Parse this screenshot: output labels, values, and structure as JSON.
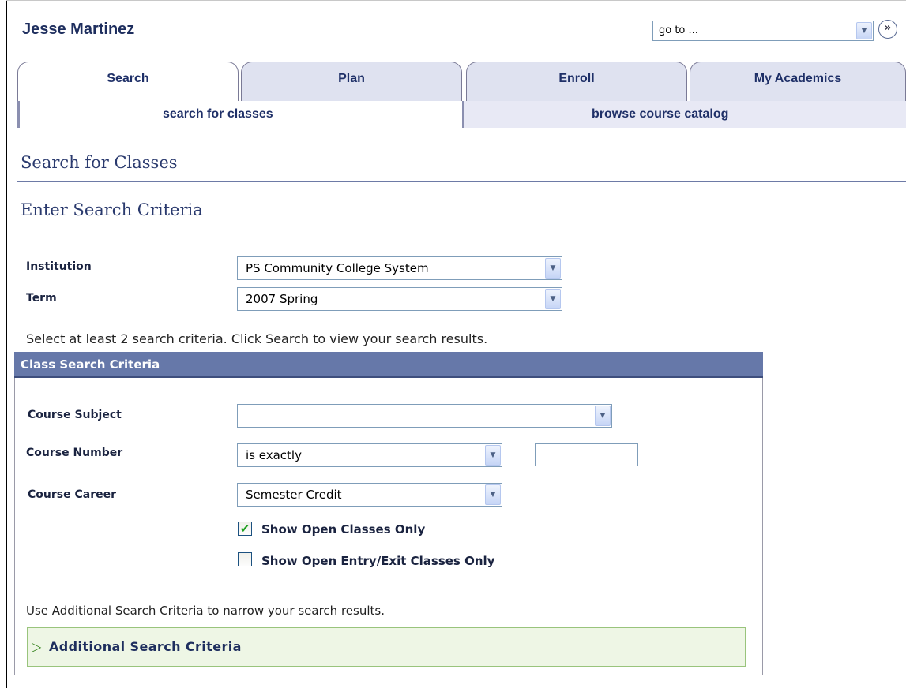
{
  "header": {
    "student_name": "Jesse Martinez",
    "goto_value": "go to ...",
    "go_button_glyph": "»"
  },
  "tabs": [
    {
      "label": "Search",
      "active": true
    },
    {
      "label": "Plan",
      "active": false
    },
    {
      "label": "Enroll",
      "active": false
    },
    {
      "label": "My Academics",
      "active": false
    }
  ],
  "subnav": [
    {
      "label": "search for classes",
      "active": true
    },
    {
      "label": "browse course catalog",
      "active": false
    }
  ],
  "page": {
    "title": "Search for Classes",
    "subtitle": "Enter Search Criteria"
  },
  "criteria": {
    "institution_label": "Institution",
    "institution_value": "PS Community College System",
    "term_label": "Term",
    "term_value": "2007 Spring",
    "instructions": "Select at least 2 search criteria. Click Search to view your search results."
  },
  "class_search": {
    "header": "Class Search Criteria",
    "course_subject_label": "Course Subject",
    "course_subject_value": "",
    "course_number_label": "Course Number",
    "course_number_operator": "is exactly",
    "course_number_value": "",
    "course_career_label": "Course Career",
    "course_career_value": "Semester Credit",
    "open_only_label": "Show Open Classes Only",
    "open_only_checked": true,
    "open_entry_label": "Show Open Entry/Exit Classes Only",
    "open_entry_checked": false,
    "additional_note": "Use Additional Search Criteria to narrow your search results.",
    "additional_title": "Additional Search Criteria"
  },
  "icons": {
    "dropdown": "chevron-down-icon",
    "go": "double-chevron-right-icon",
    "check": "checkmark-icon",
    "expand": "triangle-right-icon"
  },
  "colors": {
    "panel_header": "#6678a9",
    "tab_text": "#1f3068",
    "collapse_bg": "#eef6e5",
    "collapse_border": "#99c47c"
  }
}
